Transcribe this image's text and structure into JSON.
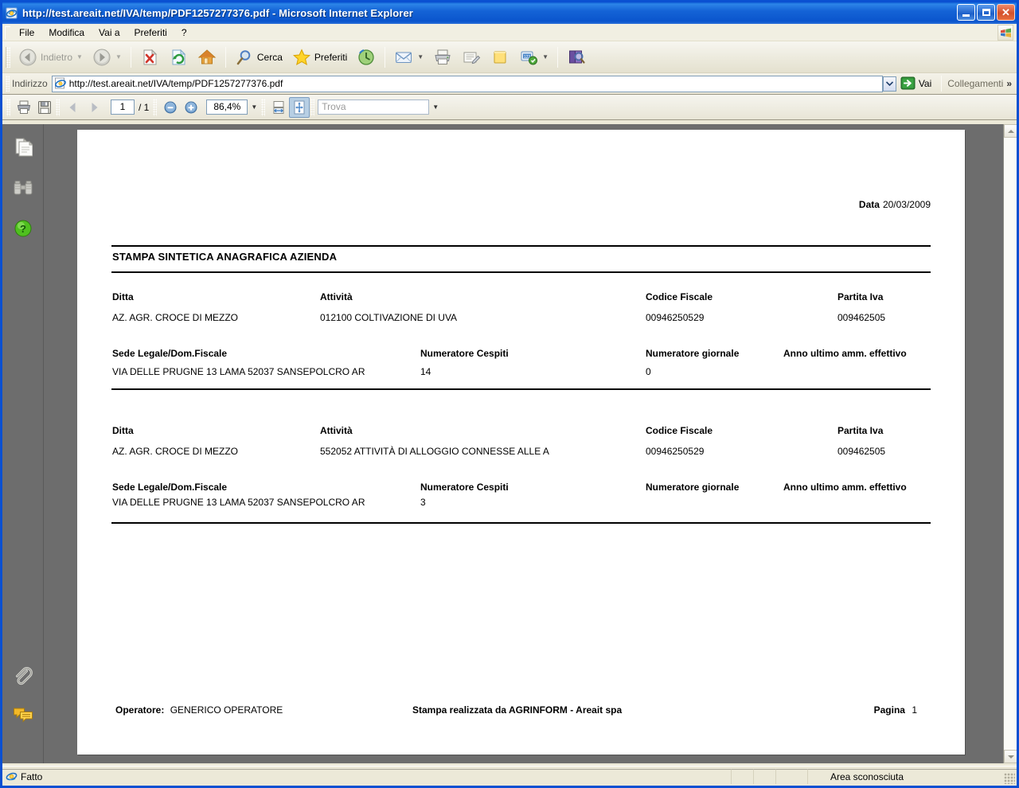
{
  "window": {
    "title": "http://test.areait.net/IVA/temp/PDF1257277376.pdf - Microsoft Internet Explorer",
    "minimize_label": "Riduci a icona",
    "maximize_label": "Ingrandisci",
    "close_label": "Chiudi"
  },
  "menu": {
    "items": [
      {
        "label": "File"
      },
      {
        "label": "Modifica"
      },
      {
        "label": "Vai a"
      },
      {
        "label": "Preferiti"
      },
      {
        "label": "?"
      }
    ]
  },
  "toolbar": {
    "back_label": "Indietro",
    "forward_label": "",
    "stop_label": "",
    "refresh_label": "",
    "home_label": "",
    "search_label": "Cerca",
    "favorites_label": "Preferiti",
    "history_label": "",
    "mail_label": "",
    "print_label": "",
    "edit_label": "",
    "notes_label": "",
    "messenger_label": "",
    "research_label": ""
  },
  "address": {
    "label": "Indirizzo",
    "value": "http://test.areait.net/IVA/temp/PDF1257277376.pdf",
    "go_label": "Vai",
    "links_label": "Collegamenti",
    "overflow_label": "»"
  },
  "pdf_toolbar": {
    "print_label": "Stampa",
    "save_label": "Salva una copia",
    "prev_label": "Pagina precedente",
    "next_label": "Pagina successiva",
    "page_current": "1",
    "page_total": "/ 1",
    "zoom_out_label": "Riduci",
    "zoom_in_label": "Ingrandisci",
    "zoom_value": "86,4%",
    "fit_width_label": "Adatta larghezza",
    "fit_page_label": "Adatta pagina",
    "find_placeholder": "Trova"
  },
  "navpane": {
    "pages_label": "Pagine",
    "search_label": "Cerca",
    "help_label": "Guida",
    "attachments_label": "Allegati",
    "comments_label": "Commenti"
  },
  "document": {
    "date_label": "Data",
    "date_value": "20/03/2009",
    "title": "STAMPA SINTETICA ANAGRAFICA AZIENDA",
    "records": [
      {
        "ditta_label": "Ditta",
        "ditta_value": "AZ. AGR. CROCE DI MEZZO",
        "attivita_label": "Attività",
        "attivita_value": "012100 COLTIVAZIONE DI UVA",
        "codice_fiscale_label": "Codice Fiscale",
        "codice_fiscale_value": "00946250529",
        "partita_iva_label": "Partita Iva",
        "partita_iva_value": "009462505",
        "sede_label": "Sede Legale/Dom.Fiscale",
        "sede_value": "VIA DELLE PRUGNE 13 LAMA 52037 SANSEPOLCRO AR",
        "num_cespiti_label": "Numeratore Cespiti",
        "num_cespiti_value": "14",
        "num_giornale_label": "Numeratore giornale",
        "num_giornale_value": "0",
        "anno_label": "Anno ultimo amm. effettivo",
        "anno_value": ""
      },
      {
        "ditta_label": "Ditta",
        "ditta_value": "AZ. AGR. CROCE DI MEZZO",
        "attivita_label": "Attività",
        "attivita_value": "552052 ATTIVITÀ DI ALLOGGIO CONNESSE ALLE A",
        "codice_fiscale_label": "Codice Fiscale",
        "codice_fiscale_value": "00946250529",
        "partita_iva_label": "Partita Iva",
        "partita_iva_value": "009462505",
        "sede_label": "Sede Legale/Dom.Fiscale",
        "sede_value": "VIA DELLE PRUGNE 13 LAMA 52037 SANSEPOLCRO AR",
        "num_cespiti_label": "Numeratore Cespiti",
        "num_cespiti_value": "3",
        "num_giornale_label": "Numeratore giornale",
        "num_giornale_value": "",
        "anno_label": "Anno ultimo amm. effettivo",
        "anno_value": ""
      }
    ],
    "footer": {
      "operatore_label": "Operatore:",
      "operatore_value": "GENERICO OPERATORE",
      "center": "Stampa realizzata da AGRINFORM - Areait spa",
      "page_label": "Pagina",
      "page_value": "1"
    }
  },
  "statusbar": {
    "status_text": "Fatto",
    "zone_text": "Area sconosciuta"
  },
  "colors": {
    "title_blue": "#0a50d2",
    "chrome_beige": "#ece9d8",
    "viewer_gray": "#6d6d6d",
    "page_white": "#ffffff",
    "accent_green": "#2f9e2f"
  }
}
